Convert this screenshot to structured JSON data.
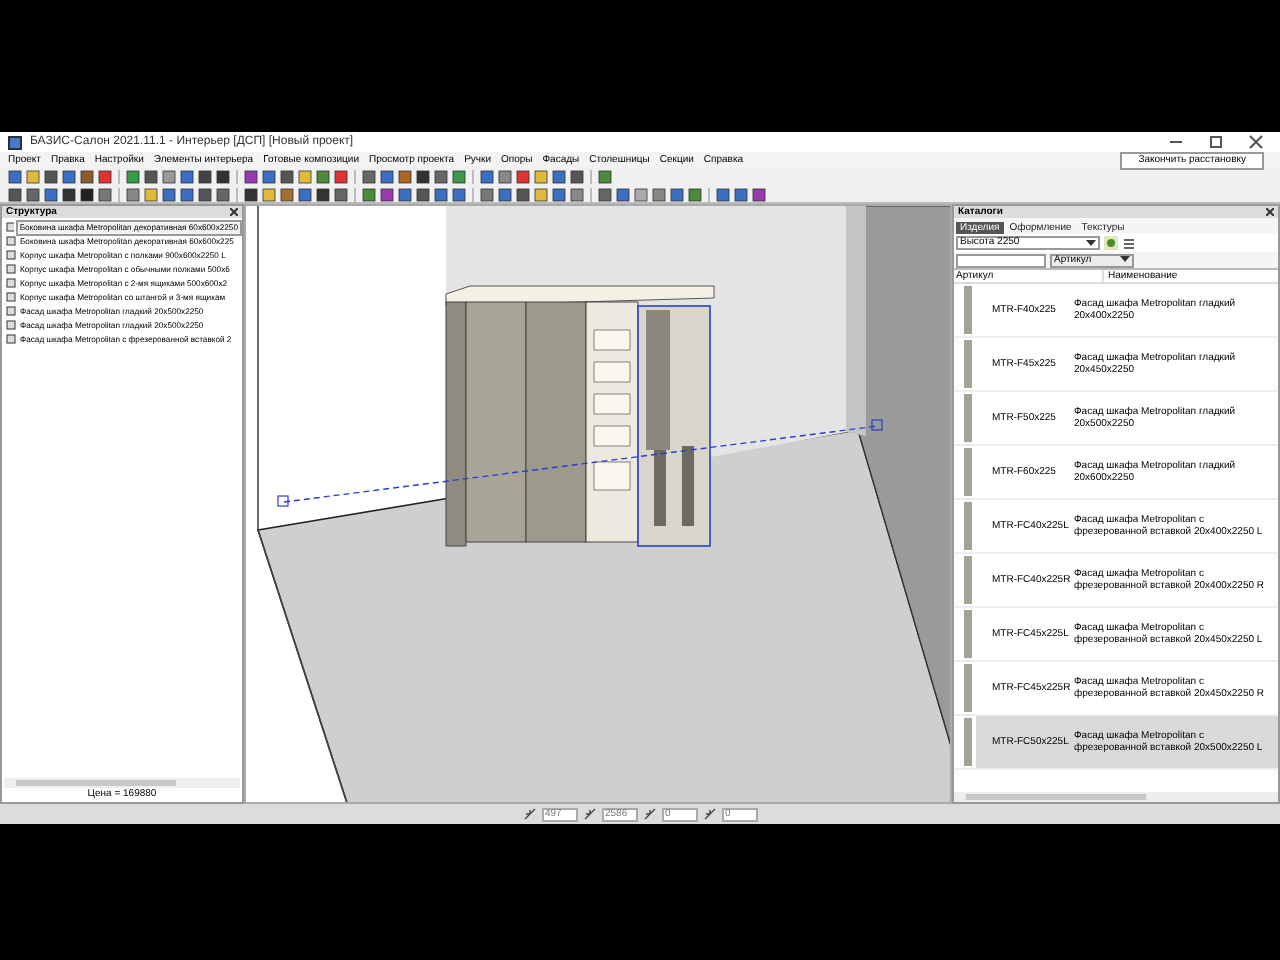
{
  "window": {
    "title": "БАЗИС-Салон 2021.11.1 - Интерьер [ДСП] [Новый проект]"
  },
  "finish_button": "Закончить расстановку",
  "menu": [
    "Проект",
    "Правка",
    "Настройки",
    "Элементы интерьера",
    "Готовые композиции",
    "Просмотр проекта",
    "Ручки",
    "Опоры",
    "Фасады",
    "Столешницы",
    "Секции",
    "Справка"
  ],
  "structure_panel": {
    "title": "Структура",
    "items": [
      {
        "label": "Боковина шкафа Metropolitan декоративная 60x600x2250",
        "selected": true
      },
      {
        "label": "Боковина шкафа Metropolitan декоративная 60x600x225",
        "selected": false
      },
      {
        "label": "Корпус шкафа Metropolitan с полками 900x600x2250 L",
        "selected": false
      },
      {
        "label": "Корпус шкафа Metropolitan с обычными полками 500x6",
        "selected": false
      },
      {
        "label": "Корпус шкафа Metropolitan с 2-мя ящиками 500x600x2",
        "selected": false
      },
      {
        "label": "Корпус шкафа Metropolitan со штангой и 3-мя ящикам",
        "selected": false
      },
      {
        "label": "Фасад шкафа Metropolitan гладкий 20x500x2250",
        "selected": false
      },
      {
        "label": "Фасад шкафа Metropolitan гладкий 20x500x2250",
        "selected": false
      },
      {
        "label": "Фасад шкафа Metropolitan с фрезерованной вставкой 2",
        "selected": false
      }
    ],
    "footer": "Цена = 169880"
  },
  "catalog": {
    "title": "Каталоги",
    "tabs": [
      {
        "label": "Изделия",
        "selected": true
      },
      {
        "label": "Оформление",
        "selected": false
      },
      {
        "label": "Текстуры",
        "selected": false
      }
    ],
    "height_filter": "Высота 2250",
    "search_by": "Артикул",
    "columns": [
      "Артикул",
      "Наименование"
    ],
    "rows": [
      {
        "article": "MTR-F40x225",
        "name": "Фасад шкафа Metropolitan гладкий 20x400x2250",
        "selected": false
      },
      {
        "article": "MTR-F45x225",
        "name": "Фасад шкафа Metropolitan гладкий 20x450x2250",
        "selected": false
      },
      {
        "article": "MTR-F50x225",
        "name": "Фасад шкафа Metropolitan гладкий 20x500x2250",
        "selected": false
      },
      {
        "article": "MTR-F60x225",
        "name": "Фасад шкафа Metropolitan гладкий 20x600x2250",
        "selected": false
      },
      {
        "article": "MTR-FC40x225L",
        "name": "Фасад шкафа Metropolitan с фрезерованной вставкой 20x400x2250 L",
        "selected": false
      },
      {
        "article": "MTR-FC40x225R",
        "name": "Фасад шкафа Metropolitan с фрезерованной вставкой 20x400x2250 R",
        "selected": false
      },
      {
        "article": "MTR-FC45x225L",
        "name": "Фасад шкафа Metropolitan с фрезерованной вставкой 20x450x2250 L",
        "selected": false
      },
      {
        "article": "MTR-FC45x225R",
        "name": "Фасад шкафа Metropolitan с фрезерованной вставкой 20x450x2250 R",
        "selected": false
      },
      {
        "article": "MTR-FC50x225L",
        "name": "Фасад шкафа Metropolitan с фрезерованной вставкой 20x500x2250 L",
        "selected": true
      }
    ]
  },
  "status_fields": [
    "497",
    "2586",
    "0",
    "0"
  ]
}
